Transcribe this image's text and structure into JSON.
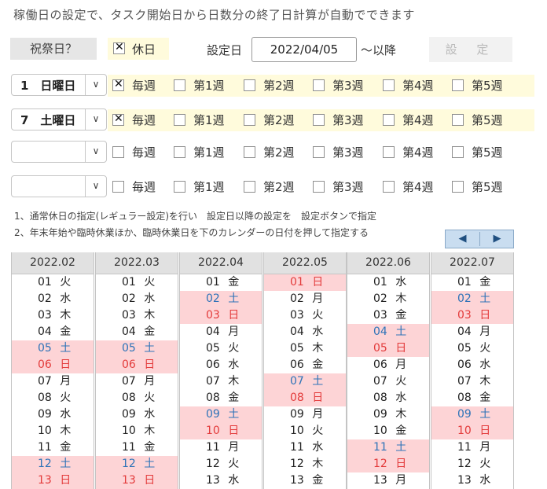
{
  "title": "稼働日の設定で、タスク開始日から日数分の終了日計算が自動でできます",
  "holiday_query_label": "祝祭日？",
  "holiday_checkbox_label": "休日",
  "date_label": "設定日",
  "date_value": "2022/04/05",
  "after_label": "～以降",
  "set_button": "設 定",
  "week_labels": [
    "毎週",
    "第1週",
    "第2週",
    "第3週",
    "第4週",
    "第5週"
  ],
  "rows": [
    {
      "select": "1　日曜日",
      "every_week_checked": true
    },
    {
      "select": "7　土曜日",
      "every_week_checked": true
    },
    {
      "select": "",
      "every_week_checked": false
    },
    {
      "select": "",
      "every_week_checked": false
    }
  ],
  "notes": [
    "1、通常休日の指定(レギュラー設定)を行い　設定日以降の設定を　設定ボタンで指定",
    "2、年末年始や臨時休業ほか、臨時休業日を下のカレンダーの日付を押して指定する"
  ],
  "nav": {
    "prev": "◀",
    "next": "▶"
  },
  "colors": {
    "holiday_bg": "#fdd4d6",
    "saturday": "#2e73b8",
    "sunday": "#e33b3b",
    "highlight_row": "#fffbdc"
  },
  "calendars": [
    {
      "month": "2022.02",
      "days": [
        {
          "d": "01",
          "w": "火",
          "t": "n"
        },
        {
          "d": "02",
          "w": "水",
          "t": "n"
        },
        {
          "d": "03",
          "w": "木",
          "t": "n"
        },
        {
          "d": "04",
          "w": "金",
          "t": "n"
        },
        {
          "d": "05",
          "w": "土",
          "t": "sat"
        },
        {
          "d": "06",
          "w": "日",
          "t": "sun"
        },
        {
          "d": "07",
          "w": "月",
          "t": "n"
        },
        {
          "d": "08",
          "w": "火",
          "t": "n"
        },
        {
          "d": "09",
          "w": "水",
          "t": "n"
        },
        {
          "d": "10",
          "w": "木",
          "t": "n"
        },
        {
          "d": "11",
          "w": "金",
          "t": "n"
        },
        {
          "d": "12",
          "w": "土",
          "t": "sat"
        },
        {
          "d": "13",
          "w": "日",
          "t": "sun"
        }
      ]
    },
    {
      "month": "2022.03",
      "days": [
        {
          "d": "01",
          "w": "火",
          "t": "n"
        },
        {
          "d": "02",
          "w": "水",
          "t": "n"
        },
        {
          "d": "03",
          "w": "木",
          "t": "n"
        },
        {
          "d": "04",
          "w": "金",
          "t": "n"
        },
        {
          "d": "05",
          "w": "土",
          "t": "sat"
        },
        {
          "d": "06",
          "w": "日",
          "t": "sun"
        },
        {
          "d": "07",
          "w": "月",
          "t": "n"
        },
        {
          "d": "08",
          "w": "火",
          "t": "n"
        },
        {
          "d": "09",
          "w": "水",
          "t": "n"
        },
        {
          "d": "10",
          "w": "木",
          "t": "n"
        },
        {
          "d": "11",
          "w": "金",
          "t": "n"
        },
        {
          "d": "12",
          "w": "土",
          "t": "sat"
        },
        {
          "d": "13",
          "w": "日",
          "t": "sun"
        }
      ]
    },
    {
      "month": "2022.04",
      "days": [
        {
          "d": "01",
          "w": "金",
          "t": "n"
        },
        {
          "d": "02",
          "w": "土",
          "t": "sat"
        },
        {
          "d": "03",
          "w": "日",
          "t": "sun"
        },
        {
          "d": "04",
          "w": "月",
          "t": "n"
        },
        {
          "d": "05",
          "w": "火",
          "t": "n"
        },
        {
          "d": "06",
          "w": "水",
          "t": "n"
        },
        {
          "d": "07",
          "w": "木",
          "t": "n"
        },
        {
          "d": "08",
          "w": "金",
          "t": "n"
        },
        {
          "d": "09",
          "w": "土",
          "t": "sat"
        },
        {
          "d": "10",
          "w": "日",
          "t": "sun"
        },
        {
          "d": "11",
          "w": "月",
          "t": "n"
        },
        {
          "d": "12",
          "w": "火",
          "t": "n"
        },
        {
          "d": "13",
          "w": "水",
          "t": "n"
        }
      ]
    },
    {
      "month": "2022.05",
      "days": [
        {
          "d": "01",
          "w": "日",
          "t": "sun"
        },
        {
          "d": "02",
          "w": "月",
          "t": "n"
        },
        {
          "d": "03",
          "w": "火",
          "t": "n"
        },
        {
          "d": "04",
          "w": "水",
          "t": "n"
        },
        {
          "d": "05",
          "w": "木",
          "t": "n"
        },
        {
          "d": "06",
          "w": "金",
          "t": "n"
        },
        {
          "d": "07",
          "w": "土",
          "t": "sat"
        },
        {
          "d": "08",
          "w": "日",
          "t": "sun"
        },
        {
          "d": "09",
          "w": "月",
          "t": "n"
        },
        {
          "d": "10",
          "w": "火",
          "t": "n"
        },
        {
          "d": "11",
          "w": "水",
          "t": "n"
        },
        {
          "d": "12",
          "w": "木",
          "t": "n"
        },
        {
          "d": "13",
          "w": "金",
          "t": "n"
        }
      ]
    },
    {
      "month": "2022.06",
      "days": [
        {
          "d": "01",
          "w": "水",
          "t": "n"
        },
        {
          "d": "02",
          "w": "木",
          "t": "n"
        },
        {
          "d": "03",
          "w": "金",
          "t": "n"
        },
        {
          "d": "04",
          "w": "土",
          "t": "sat"
        },
        {
          "d": "05",
          "w": "日",
          "t": "sun"
        },
        {
          "d": "06",
          "w": "月",
          "t": "n"
        },
        {
          "d": "07",
          "w": "火",
          "t": "n"
        },
        {
          "d": "08",
          "w": "水",
          "t": "n"
        },
        {
          "d": "09",
          "w": "木",
          "t": "n"
        },
        {
          "d": "10",
          "w": "金",
          "t": "n"
        },
        {
          "d": "11",
          "w": "土",
          "t": "sat"
        },
        {
          "d": "12",
          "w": "日",
          "t": "sun"
        },
        {
          "d": "13",
          "w": "月",
          "t": "n"
        }
      ]
    },
    {
      "month": "2022.07",
      "days": [
        {
          "d": "01",
          "w": "金",
          "t": "n"
        },
        {
          "d": "02",
          "w": "土",
          "t": "sat"
        },
        {
          "d": "03",
          "w": "日",
          "t": "sun"
        },
        {
          "d": "04",
          "w": "月",
          "t": "n"
        },
        {
          "d": "05",
          "w": "火",
          "t": "n"
        },
        {
          "d": "06",
          "w": "水",
          "t": "n"
        },
        {
          "d": "07",
          "w": "木",
          "t": "n"
        },
        {
          "d": "08",
          "w": "金",
          "t": "n"
        },
        {
          "d": "09",
          "w": "土",
          "t": "sat"
        },
        {
          "d": "10",
          "w": "日",
          "t": "sun"
        },
        {
          "d": "11",
          "w": "月",
          "t": "n"
        },
        {
          "d": "12",
          "w": "火",
          "t": "n"
        },
        {
          "d": "13",
          "w": "水",
          "t": "n"
        }
      ]
    }
  ]
}
